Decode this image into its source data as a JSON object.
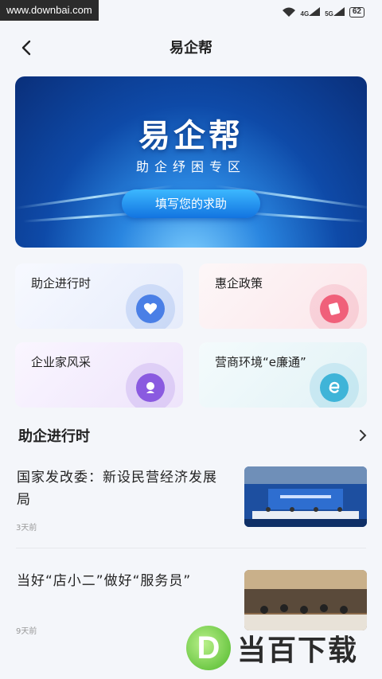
{
  "status_bar": {
    "watermark": "www.downbai.com",
    "battery": "62"
  },
  "header": {
    "title": "易企帮"
  },
  "banner": {
    "title": "易企帮",
    "subtitle": "助企纾困专区",
    "button": "填写您的求助"
  },
  "cards": [
    {
      "label": "助企进行时"
    },
    {
      "label": "惠企政策"
    },
    {
      "label": "企业家风采"
    },
    {
      "label": "营商环境“e廉通”"
    }
  ],
  "section": {
    "title": "助企进行时"
  },
  "news": [
    {
      "title": "国家发改委：新设民营经济发展局",
      "time": "3天前"
    },
    {
      "title": "当好“店小二”做好“服务员”",
      "time": "9天前"
    }
  ],
  "logo_watermark": {
    "text": "当百下载",
    "letter": "D"
  },
  "colors": {
    "accent": "#1a6fd8",
    "card_blue": "#4a7fe6",
    "card_pink": "#f0607a",
    "card_purple": "#8a5ae0",
    "card_teal": "#3fb4d8"
  }
}
